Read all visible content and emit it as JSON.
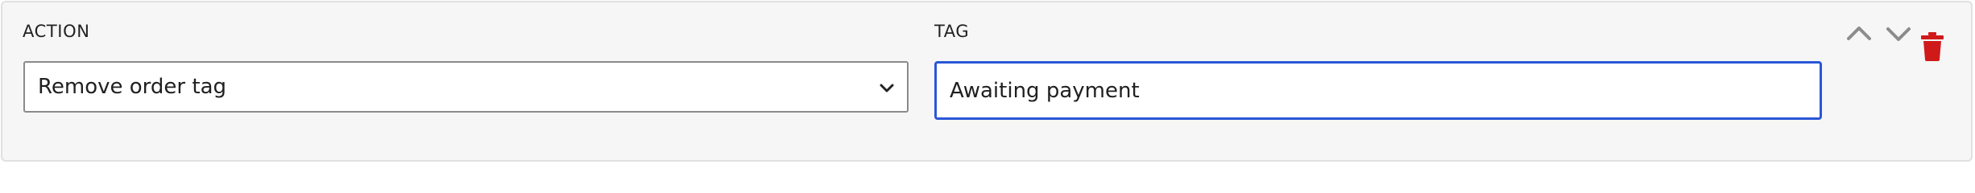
{
  "action": {
    "label": "ACTION",
    "selected": "Remove order tag"
  },
  "tag": {
    "label": "TAG",
    "value": "Awaiting payment"
  },
  "controls": {
    "move_up_icon": "chevron-up-icon",
    "move_down_icon": "chevron-down-icon",
    "delete_icon": "trash-icon"
  },
  "colors": {
    "focus_border": "#2a56d8",
    "delete": "#d01a1a",
    "panel_bg": "#f5f6f5"
  }
}
